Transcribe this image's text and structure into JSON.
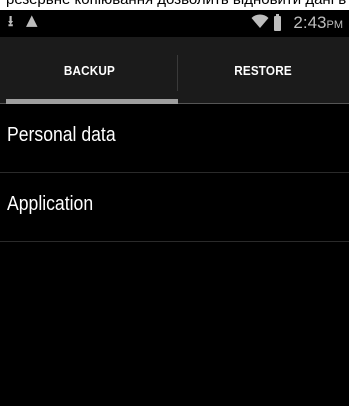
{
  "overlay_caption": "резервне копіювання дозволить відновити дані в будь-який",
  "status_bar": {
    "left_icons": [
      "download-icon",
      "warning-icon"
    ],
    "right_icons": [
      "wifi-icon",
      "battery-icon"
    ],
    "time": "2:43",
    "ampm": "PM"
  },
  "tabs": [
    {
      "label": "BACKUP",
      "selected": true
    },
    {
      "label": "RESTORE",
      "selected": false
    }
  ],
  "list": {
    "items": [
      {
        "label": "Personal data"
      },
      {
        "label": "Application"
      }
    ]
  },
  "colors": {
    "background": "#000000",
    "tabbar": "#1b1b1b",
    "indicator": "#9e9e9e",
    "text": "#ffffff",
    "status_icons": "#bdbdbd"
  }
}
